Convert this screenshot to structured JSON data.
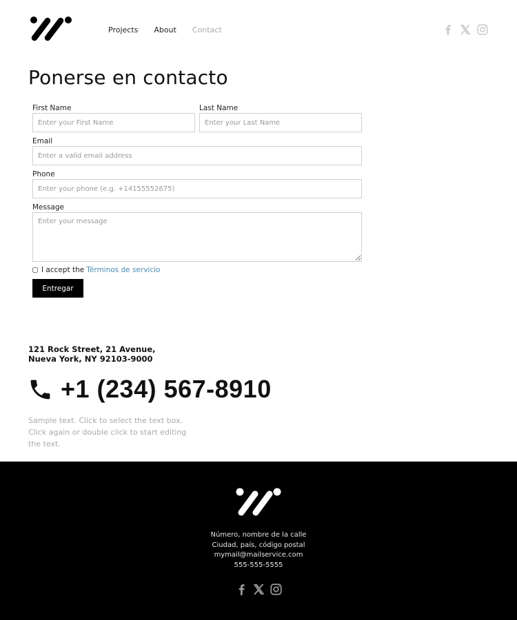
{
  "header": {
    "logo_icon": "brand-logo-slashes",
    "nav": [
      {
        "label": "Projects",
        "active": false
      },
      {
        "label": "About",
        "active": false
      },
      {
        "label": "Contact",
        "active": true
      }
    ],
    "social": [
      "facebook-icon",
      "x-twitter-icon",
      "instagram-icon"
    ],
    "social_color": "#cccccc"
  },
  "page": {
    "title": "Ponerse en contacto"
  },
  "form": {
    "first_name": {
      "label": "First Name",
      "placeholder": "Enter your First Name",
      "value": ""
    },
    "last_name": {
      "label": "Last Name",
      "placeholder": "Enter your Last Name",
      "value": ""
    },
    "email": {
      "label": "Email",
      "placeholder": "Enter a valid email address",
      "value": ""
    },
    "phone": {
      "label": "Phone",
      "placeholder": "Enter your phone (e.g. +14155552675)",
      "value": ""
    },
    "message": {
      "label": "Message",
      "placeholder": "Enter your message",
      "value": ""
    },
    "accept": {
      "prefix": "I accept the",
      "link": "Términos de servicio",
      "checked": false,
      "link_color": "#4a8bb5"
    },
    "submit_label": "Entregar"
  },
  "contact": {
    "address_line1": "121 Rock Street, 21 Avenue,",
    "address_line2": "Nueva York, NY 92103-9000",
    "phone_icon": "phone-icon",
    "phone": "+1 (234) 567-8910",
    "sample_text": "Sample text. Click to select the text box. Click again or double click to start editing the text."
  },
  "footer": {
    "background": "#000000",
    "lines": [
      "Número, nombre de la calle",
      "Ciudad, país, código postal",
      "mymail@mailservice.com",
      "555-555-5555"
    ],
    "social": [
      "facebook-icon",
      "x-twitter-icon",
      "instagram-icon"
    ],
    "social_color": "#9a9a9a"
  }
}
